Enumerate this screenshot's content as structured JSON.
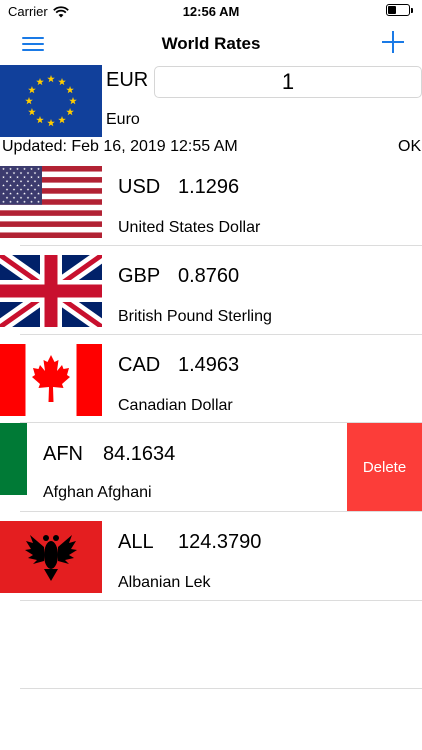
{
  "status_bar": {
    "carrier": "Carrier",
    "time": "12:56 AM",
    "battery_level": 0.4
  },
  "nav": {
    "title": "World Rates",
    "menu_icon": "hamburger-menu-icon",
    "add_icon": "plus-icon"
  },
  "base": {
    "code": "EUR",
    "name": "Euro",
    "amount": "1",
    "flag": "eu-flag"
  },
  "updated_text": "Updated: Feb 16, 2019 12:55 AM",
  "ok_text": "OK",
  "rows": [
    {
      "code": "USD",
      "rate": "1.1296",
      "name": "United States Dollar",
      "flag": "us-flag"
    },
    {
      "code": "GBP",
      "rate": "0.8760",
      "name": "British Pound Sterling",
      "flag": "uk-flag"
    },
    {
      "code": "CAD",
      "rate": "1.4963",
      "name": "Canadian Dollar",
      "flag": "canada-flag"
    },
    {
      "code": "AFN",
      "rate": "84.1634",
      "name": "Afghan Afghani",
      "flag": "afghanistan-flag",
      "swiped": true,
      "delete_label": "Delete"
    },
    {
      "code": "ALL",
      "rate": "124.3790",
      "name": "Albanian Lek",
      "flag": "albania-flag"
    }
  ],
  "colors": {
    "accent": "#1a7ae6",
    "delete": "#fc3d39",
    "separator": "#dcdcdc"
  }
}
